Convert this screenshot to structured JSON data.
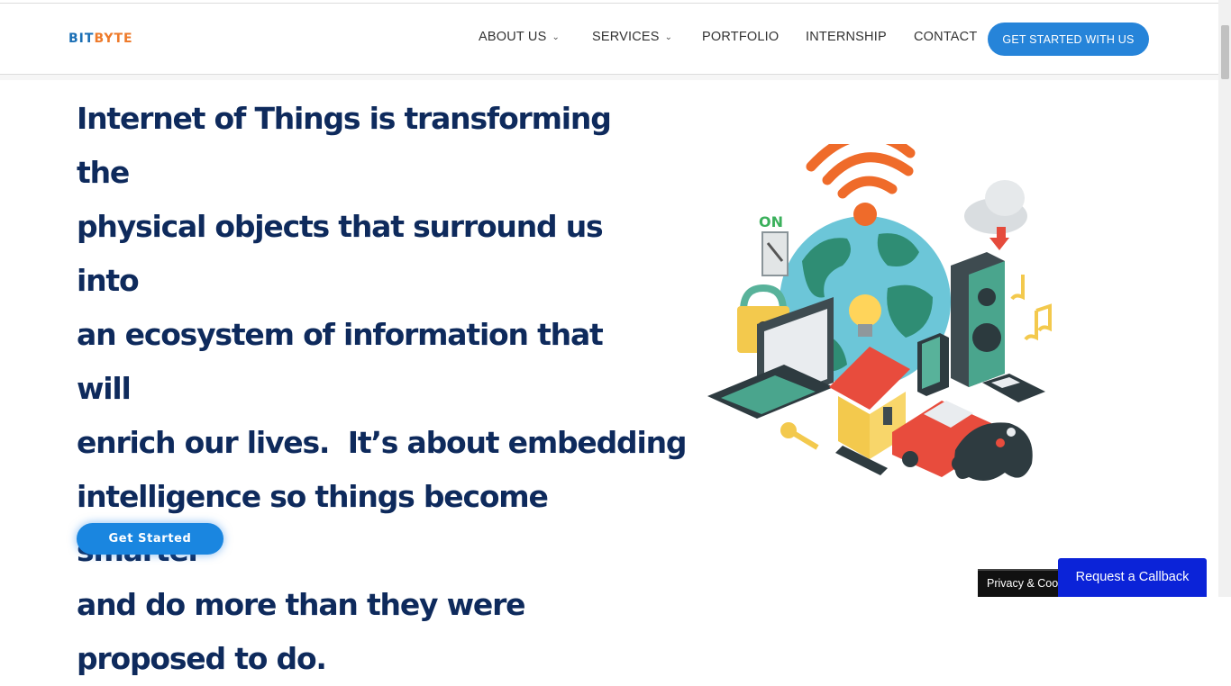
{
  "header": {
    "logo": {
      "part1": "BIT",
      "part2": "BYTE"
    },
    "nav": [
      {
        "label": "ABOUT US",
        "has_dropdown": true
      },
      {
        "label": "SERVICES",
        "has_dropdown": true
      },
      {
        "label": "PORTFOLIO",
        "has_dropdown": false
      },
      {
        "label": "INTERNSHIP",
        "has_dropdown": false
      },
      {
        "label": "CONTACT",
        "has_dropdown": false
      }
    ],
    "cta_label": "GET STARTED WITH US"
  },
  "hero": {
    "lines": [
      "Internet of Things is transforming the",
      "physical objects that surround us into",
      "an ecosystem of information that will",
      "enrich our lives.  It’s about embedding",
      "intelligence so things become smarter",
      "and do more than they were",
      "proposed to do."
    ],
    "button_label": "Get Started",
    "illustration_labels": {
      "switch": "ON"
    }
  },
  "widgets": {
    "privacy_label": "Privacy & Cookies",
    "callback_label": "Request a Callback"
  },
  "colors": {
    "primary": "#2684d9",
    "heading": "#0e2a5c",
    "logo_bit": "#1b6fb5",
    "logo_byte": "#ee7a2a",
    "callback_bg": "#0b23d8"
  }
}
